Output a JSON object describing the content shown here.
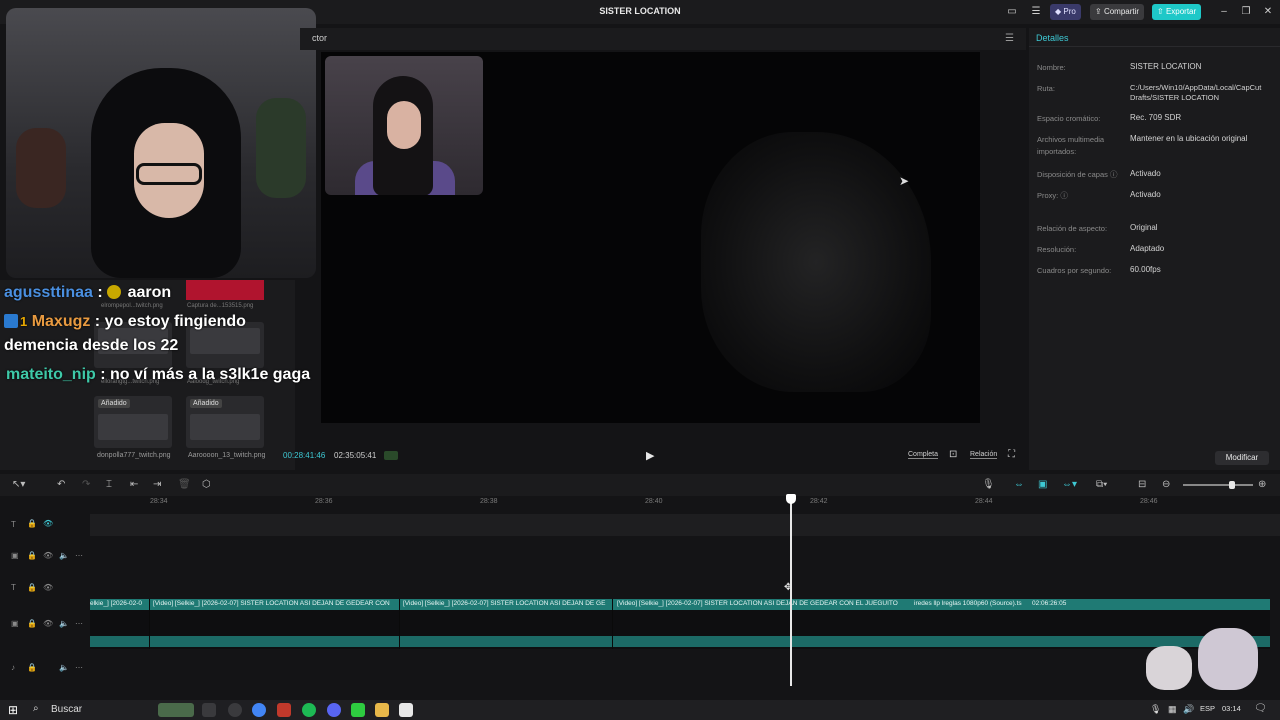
{
  "titlebar": {
    "title": "SISTER LOCATION",
    "pro_label": "Pro",
    "share_label": "Compartir",
    "export_label": "Exportar",
    "accent": "#1ec8c8"
  },
  "chat": {
    "lines": [
      {
        "user": "agussttinaa",
        "sep": " : ",
        "text": " aaron"
      },
      {
        "user": "Maxugz",
        "sep": " : ",
        "text": "yo estoy fingiendo"
      },
      {
        "user": "",
        "sep": "",
        "text": "demencia desde los 22"
      },
      {
        "user": "mateito_nip",
        "sep": " : ",
        "text": "no ví más a la s3lk1e gaga"
      }
    ],
    "badge_number": "1"
  },
  "media": {
    "top_names": [
      "elrompepol...twitch.png",
      "Captura de...153515.png"
    ],
    "mid_names": [
      "ellorangtg...twitch.png",
      "Aaloodg_twitch.png"
    ],
    "tiles": [
      {
        "added": "Añadido",
        "name": "donpolla777_twitch.png"
      },
      {
        "added": "Añadido",
        "name": "Aaroooon_13_twitch.png"
      }
    ]
  },
  "player": {
    "title": "ctor",
    "current_time": "00:28:41:46",
    "total_time": "02:35:05:41",
    "full_label": "Completa",
    "ratio_label": "Relación"
  },
  "details": {
    "title": "Detalles",
    "rows": [
      {
        "label": "Nombre:",
        "value": "SISTER LOCATION"
      },
      {
        "label": "Ruta:",
        "value": "C:/Users/Win10/AppData/Local/CapCut Drafts/SISTER LOCATION"
      },
      {
        "label": "Espacio cromático:",
        "value": "Rec. 709 SDR"
      },
      {
        "label": "Archivos multimedia importados:",
        "value": "Mantener en la ubicación original"
      },
      {
        "label": "Disposición de capas",
        "value": "Activado"
      },
      {
        "label": "Proxy:",
        "value": "Activado"
      },
      {
        "label": "Relación de aspecto:",
        "value": "Original"
      },
      {
        "label": "Resolución:",
        "value": "Adaptado"
      },
      {
        "label": "Cuadros por segundo:",
        "value": "60.00fps"
      }
    ],
    "modify_label": "Modificar"
  },
  "timeline": {
    "ticks": [
      "28:34",
      "28:36",
      "28:38",
      "28:40",
      "28:42",
      "28:44",
      "28:46"
    ],
    "clip_labels": [
      "elkie_] [2026-02-0",
      "[Video] [Selkie_] [2026-02-07] SISTER LOCATION ASI DEJAN DE GEDEAR CON",
      "[Video] [Selkie_] [2026-02-07] SISTER LOCATION ASI DEJAN DE GE",
      "[Video] [Selkie_] [2026-02-07] SISTER LOCATION ASI DEJAN DE GEDEAR CON EL JUEGUITO",
      "iredes llp lreglas 1080p60 (Source).ts",
      "02:06:26:05"
    ],
    "zoom_level": 0.72
  },
  "taskbar": {
    "search_label": "Buscar",
    "language": "ESP",
    "time": "03:14"
  }
}
